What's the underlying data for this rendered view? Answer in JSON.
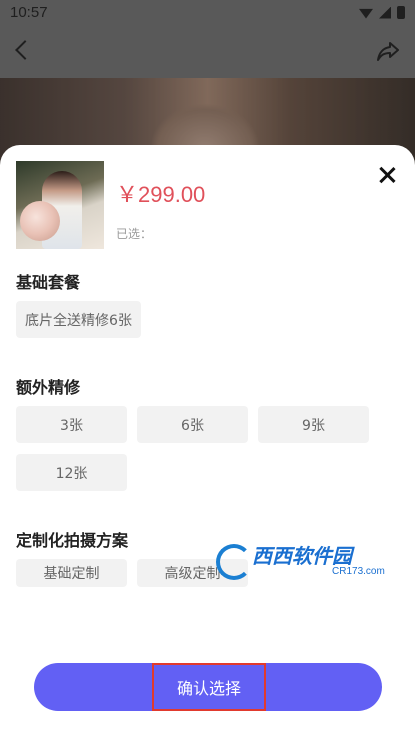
{
  "status_bar": {
    "time": "10:57"
  },
  "product": {
    "price": "￥299.00",
    "selected_label": "已选："
  },
  "sections": {
    "basic_package": {
      "title": "基础套餐",
      "options": [
        "底片全送精修6张"
      ]
    },
    "extra_retouch": {
      "title": "额外精修",
      "options": [
        "3张",
        "6张",
        "9张",
        "12张"
      ]
    },
    "custom_plan": {
      "title": "定制化拍摄方案",
      "options": [
        "基础定制",
        "高级定制"
      ]
    }
  },
  "actions": {
    "confirm_label": "确认选择"
  },
  "watermark": {
    "text": "西西软件园",
    "sub": "CR173.com"
  },
  "colors": {
    "accent": "#6260f4",
    "price": "#e0505a",
    "highlight_border": "#e13a2e"
  },
  "icons": [
    "back-icon",
    "share-icon",
    "close-icon",
    "wifi-icon",
    "signal-icon",
    "battery-icon"
  ]
}
